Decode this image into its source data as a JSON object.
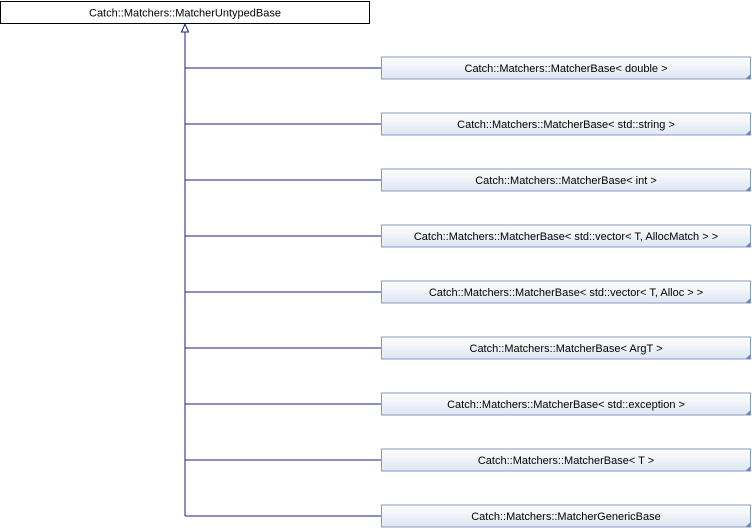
{
  "diagram": {
    "base": {
      "label": "Catch::Matchers::MatcherUntypedBase"
    },
    "children": [
      {
        "label": "Catch::Matchers::MatcherBase< double >"
      },
      {
        "label": "Catch::Matchers::MatcherBase< std::string >"
      },
      {
        "label": "Catch::Matchers::MatcherBase< int >"
      },
      {
        "label": "Catch::Matchers::MatcherBase< std::vector< T, AllocMatch > >"
      },
      {
        "label": "Catch::Matchers::MatcherBase< std::vector< T, Alloc > >"
      },
      {
        "label": "Catch::Matchers::MatcherBase< ArgT >"
      },
      {
        "label": "Catch::Matchers::MatcherBase< std::exception >"
      },
      {
        "label": "Catch::Matchers::MatcherBase< T >"
      },
      {
        "label": "Catch::Matchers::MatcherGenericBase"
      }
    ],
    "colors": {
      "edge": "#1a237e",
      "child_fill_top": "#ffffff",
      "child_fill_bottom": "#dde6f3",
      "child_border": "#8a9bbd"
    }
  }
}
